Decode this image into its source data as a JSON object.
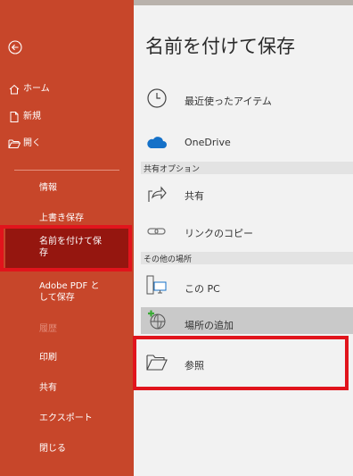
{
  "sidebar": {
    "back_icon": "back-arrow-icon",
    "items": [
      {
        "label": "ホーム",
        "icon": "home-icon"
      },
      {
        "label": "新規",
        "icon": "new-document-icon"
      },
      {
        "label": "開く",
        "icon": "open-folder-icon"
      }
    ],
    "sub_items": [
      "情報",
      "上書き保存",
      "名前を付けて保\n存",
      "Adobe PDF と\nして保存",
      "履歴",
      "印刷",
      "共有",
      "エクスポート",
      "閉じる"
    ],
    "selected": "名前を付けて保\n存",
    "colors": {
      "sidebar": "#c7462a",
      "selected": "#95160f",
      "annotation": "#e1141c"
    }
  },
  "main": {
    "title": "名前を付けて保存",
    "recent": {
      "label": "最近使ったアイテム",
      "icon": "clock-icon"
    },
    "onedrive": {
      "label": "OneDrive",
      "icon": "cloud-icon"
    },
    "share_section": "共有オプション",
    "share": {
      "label": "共有",
      "icon": "share-icon"
    },
    "copy_link": {
      "label": "リンクのコピー",
      "icon": "link-icon"
    },
    "other_section": "その他の場所",
    "this_pc": {
      "label": "この PC",
      "icon": "computer-icon"
    },
    "add_place": {
      "label": "場所の追加",
      "icon": "globe-add-icon"
    },
    "browse": {
      "label": "参照",
      "icon": "folder-icon"
    }
  }
}
